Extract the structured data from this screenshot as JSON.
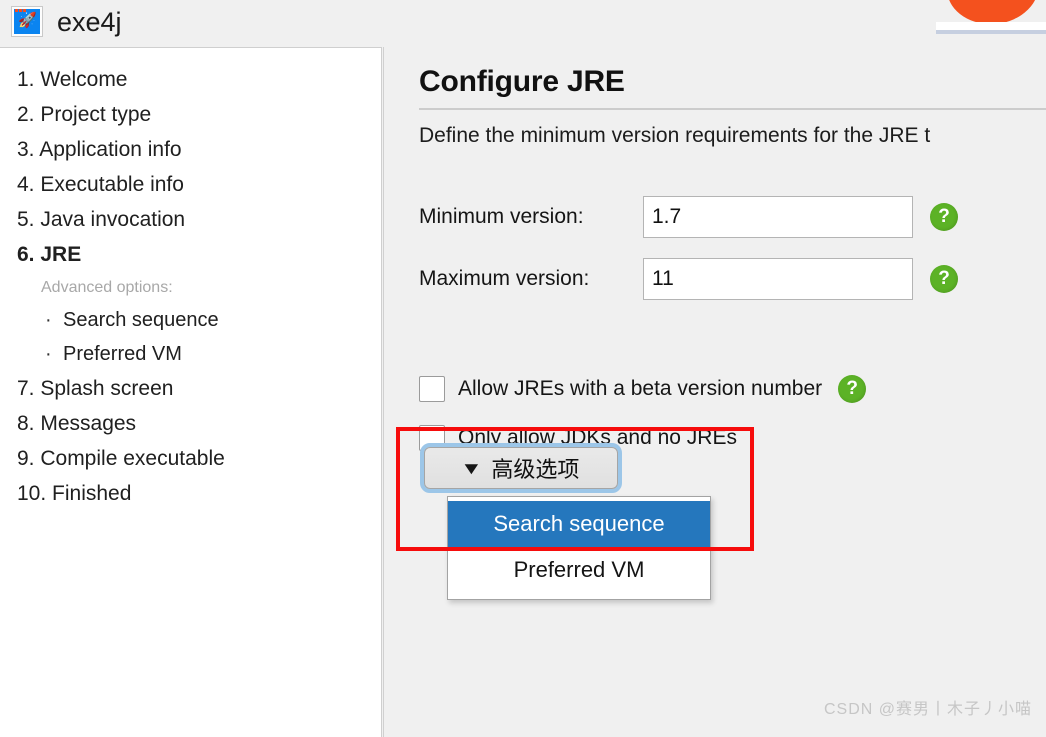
{
  "window": {
    "app_title": "exe4j",
    "app_icon": "rocket-window-icon"
  },
  "sidebar": {
    "items": [
      {
        "label": "1. Welcome",
        "current": false
      },
      {
        "label": "2. Project type",
        "current": false
      },
      {
        "label": "3. Application info",
        "current": false
      },
      {
        "label": "4. Executable info",
        "current": false
      },
      {
        "label": "5. Java invocation",
        "current": false
      },
      {
        "label": "6. JRE",
        "current": true
      }
    ],
    "advanced_caption": "Advanced options:",
    "advanced_items": [
      {
        "bullet": "·",
        "label": "Search sequence"
      },
      {
        "bullet": "·",
        "label": "Preferred VM"
      }
    ],
    "items_after": [
      {
        "label": "7. Splash screen",
        "current": false
      },
      {
        "label": "8. Messages",
        "current": false
      },
      {
        "label": "9. Compile executable",
        "current": false
      },
      {
        "label": "10. Finished",
        "current": false
      }
    ]
  },
  "main": {
    "title": "Configure JRE",
    "description": "Define the minimum version requirements for the JRE t",
    "fields": [
      {
        "label": "Minimum version:",
        "value": "1.7",
        "help": "?"
      },
      {
        "label": "Maximum version:",
        "value": "11",
        "help": "?"
      }
    ],
    "checkboxes": [
      {
        "label": "Allow JREs with a beta version number",
        "checked": false,
        "help": "?"
      },
      {
        "label": "Only allow JDKs and no JREs",
        "checked": false,
        "help": null
      }
    ],
    "advanced_button": {
      "caret": "▼",
      "label": "高级选项"
    },
    "advanced_menu": [
      {
        "label": "Search sequence",
        "selected": true
      },
      {
        "label": "Preferred VM",
        "selected": false
      }
    ]
  },
  "annotation": {
    "color": "#f60c0c"
  },
  "watermark": {
    "text": "CSDN @赛男丨木子丿小喵"
  },
  "colors": {
    "accent_blue": "#2577bd",
    "help_green": "#5cb226",
    "focus_ring": "#9cc6e8",
    "annotation_red": "#f60c0c",
    "panel_bg": "#f0f0f0",
    "sidebar_bg": "#ffffff",
    "swoosh_orange": "#f4511e"
  }
}
